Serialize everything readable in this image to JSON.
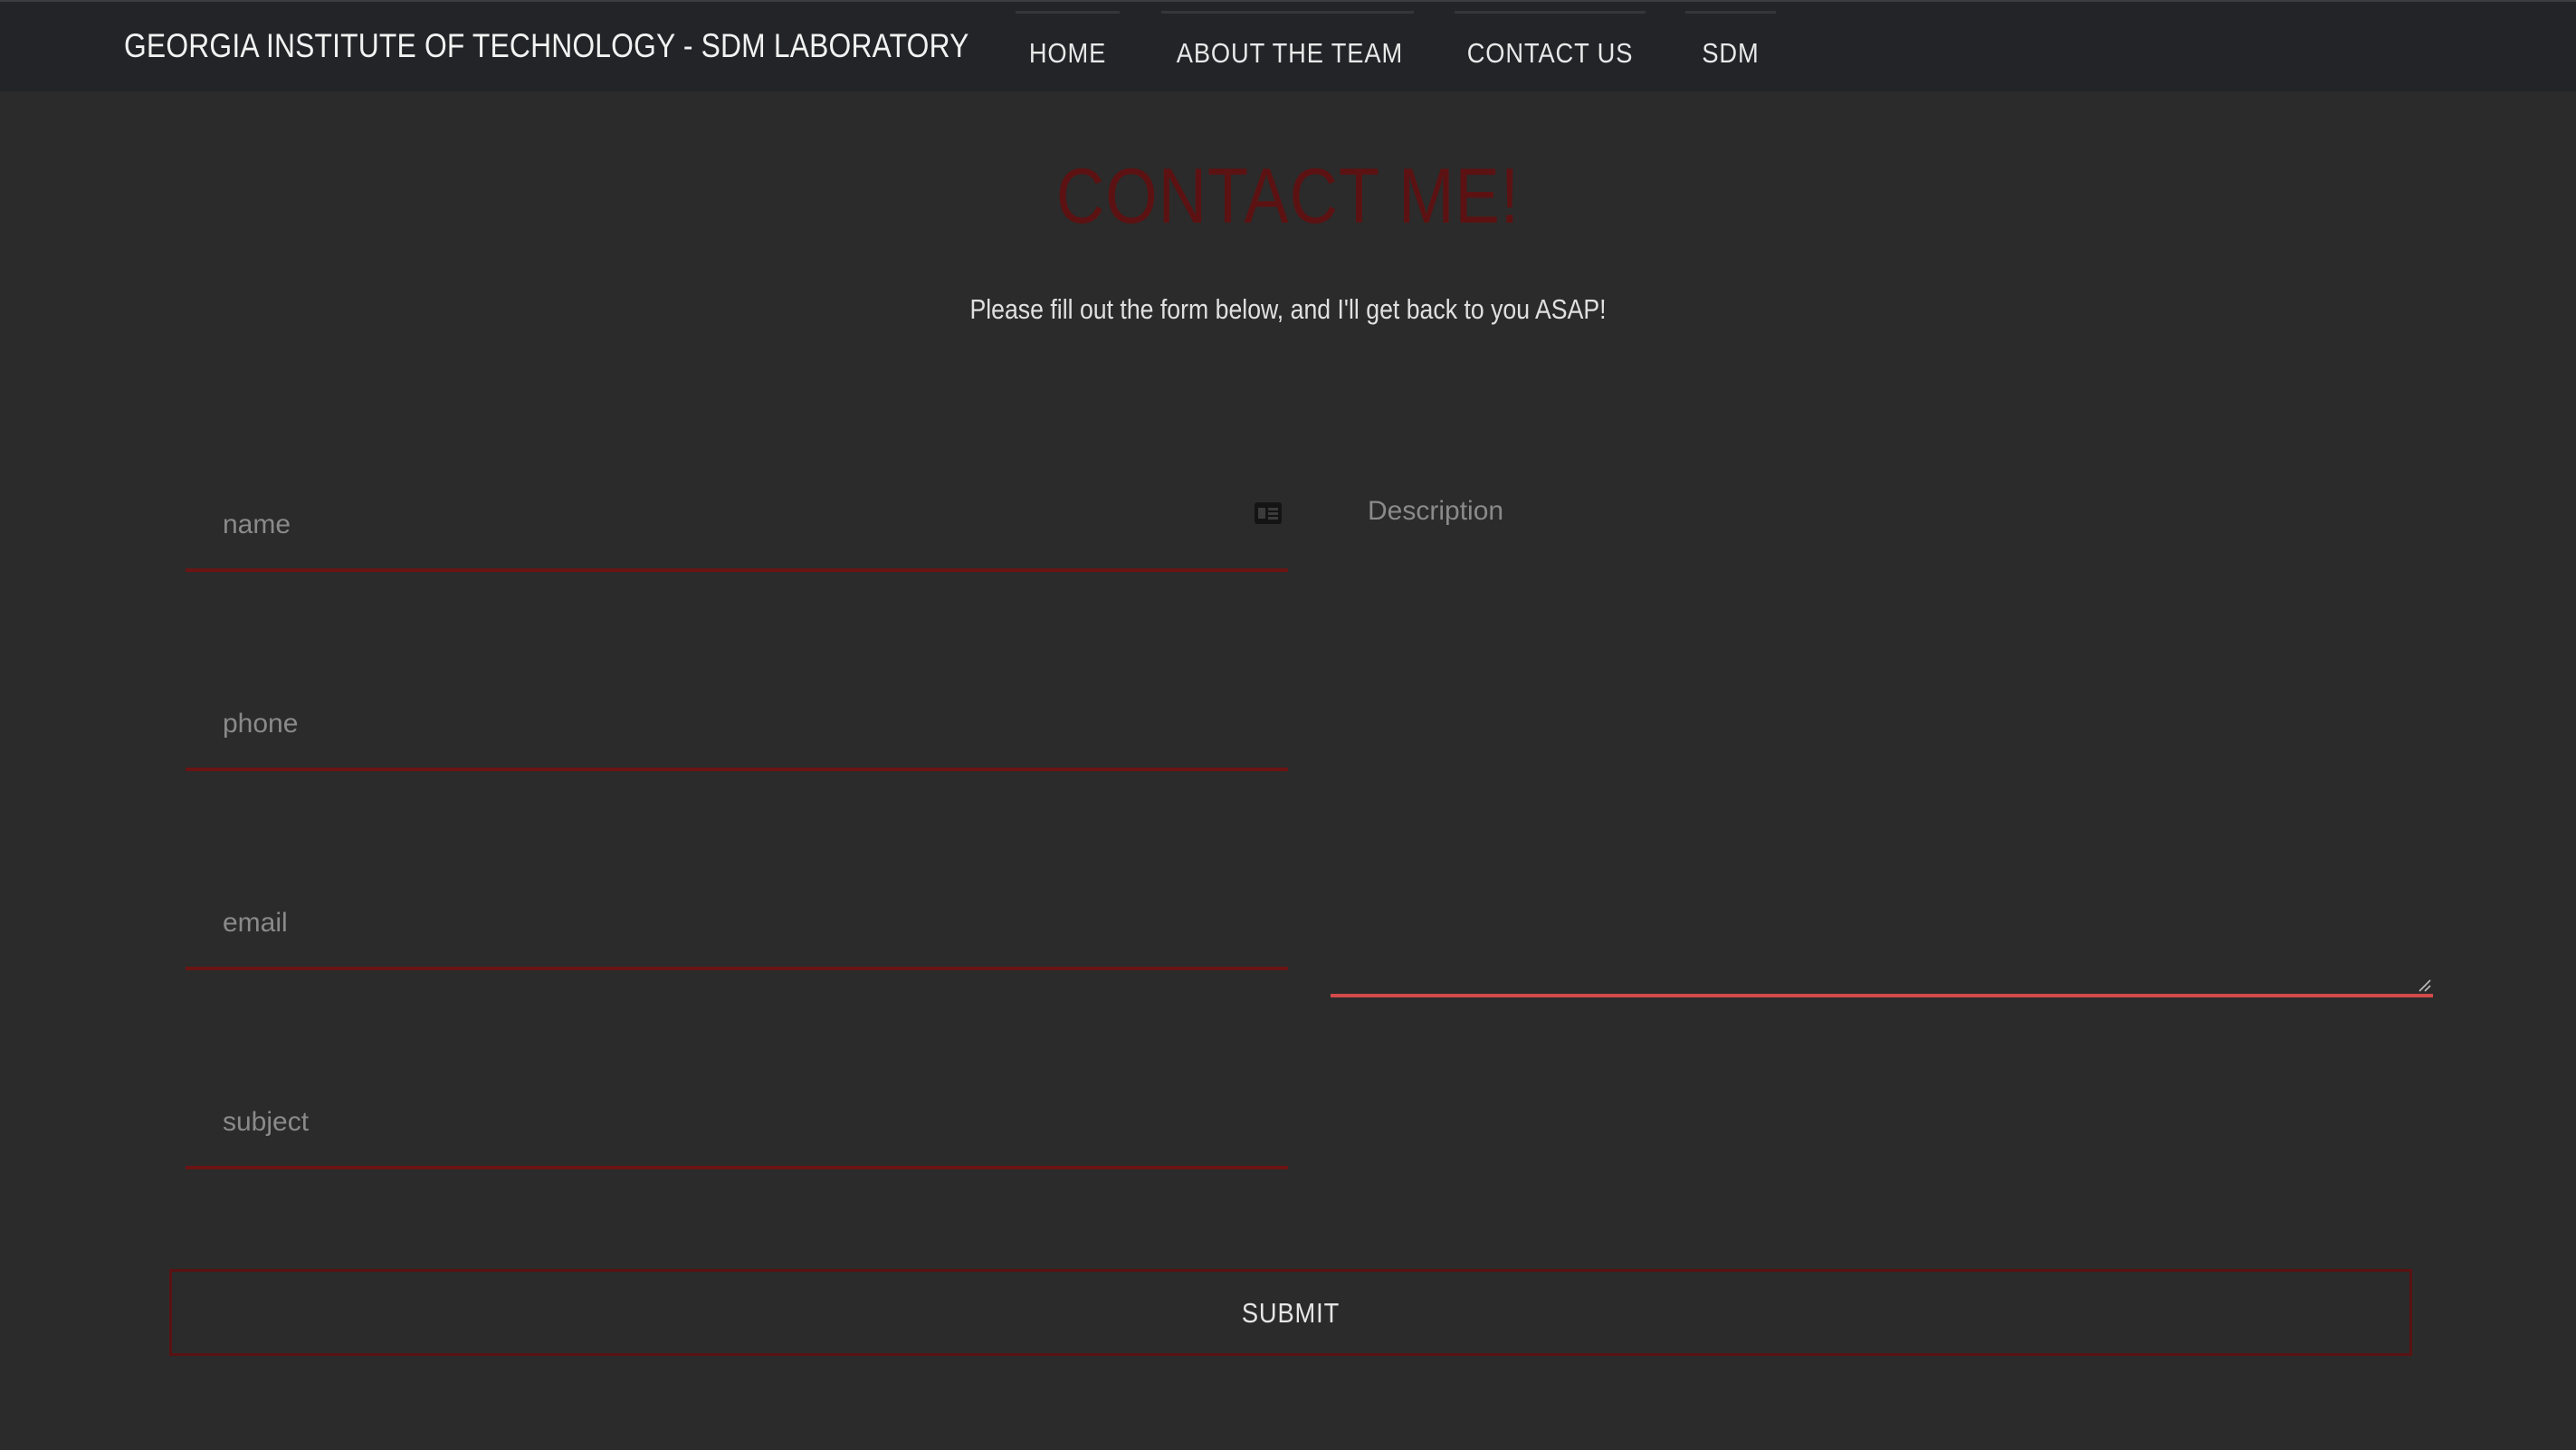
{
  "navbar": {
    "brand": "GEORGIA INSTITUTE OF TECHNOLOGY - SDM LABORATORY",
    "items": [
      {
        "label": "HOME"
      },
      {
        "label": "ABOUT THE TEAM"
      },
      {
        "label": "CONTACT US"
      },
      {
        "label": "SDM"
      }
    ]
  },
  "page": {
    "title": "CONTACT ME!",
    "subtitle": "Please fill out the form below, and I'll get back to you ASAP!"
  },
  "form": {
    "name": {
      "placeholder": "name",
      "value": "",
      "icon": "id-card-icon"
    },
    "phone": {
      "placeholder": "phone",
      "value": ""
    },
    "email": {
      "placeholder": "email",
      "value": ""
    },
    "subject": {
      "placeholder": "subject",
      "value": ""
    },
    "description": {
      "placeholder": "Description",
      "value": ""
    },
    "submit_label": "SUBMIT"
  },
  "colors": {
    "background": "#2b2b2b",
    "navbar": "#222427",
    "accent_dark_red": "#5c1212",
    "field_underline": "#6a1414",
    "textarea_focus_underline": "#d24a4a"
  }
}
